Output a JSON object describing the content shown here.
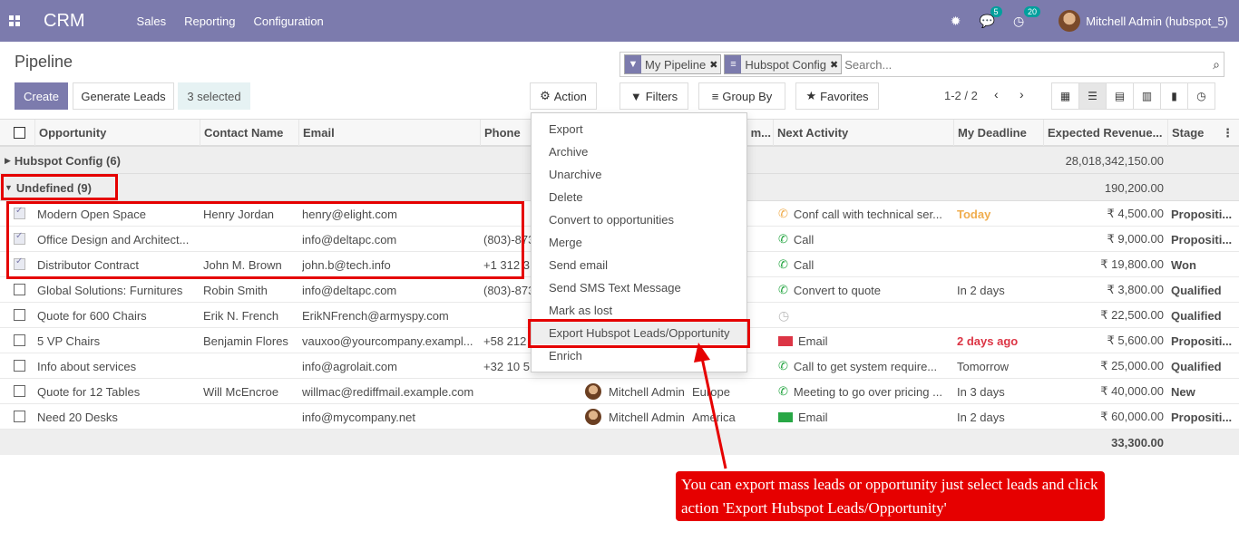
{
  "navbar": {
    "brand": "CRM",
    "menus": [
      "Sales",
      "Reporting",
      "Configuration"
    ],
    "messages_count": "5",
    "activities_count": "20",
    "user": "Mitchell Admin (hubspot_5)"
  },
  "control": {
    "breadcrumb": "Pipeline",
    "create": "Create",
    "generate_leads": "Generate Leads",
    "selected": "3 selected",
    "action": "Action",
    "filters": "Filters",
    "group_by": "Group By",
    "favorites": "Favorites",
    "pager": "1-2 / 2",
    "search_placeholder": "Search...",
    "facets": [
      "My Pipeline",
      "Hubspot Config"
    ]
  },
  "table": {
    "headers": [
      "Opportunity",
      "Contact Name",
      "Email",
      "Phone",
      "m...",
      "Next Activity",
      "My Deadline",
      "Expected Revenue...",
      "Stage"
    ],
    "groups": [
      {
        "label": "Hubspot Config (6)",
        "total": "28,018,342,150.00"
      },
      {
        "label": "Undefined (9)",
        "total": "190,200.00"
      }
    ],
    "rows": [
      {
        "opp": "Modern Open Space",
        "contact": "Henry Jordan",
        "email": "henry@elight.com",
        "phone": "",
        "salesperson": "",
        "team": "",
        "activity": "Conf call with technical ser...",
        "deadline": "Today",
        "revenue": "₹ 4,500.00",
        "stage": "Propositi..."
      },
      {
        "opp": "Office Design and Architect...",
        "contact": "",
        "email": "info@deltapc.com",
        "phone": "(803)-873",
        "salesperson": "",
        "team": "",
        "activity": "Call",
        "deadline": "",
        "revenue": "₹ 9,000.00",
        "stage": "Propositi..."
      },
      {
        "opp": "Distributor Contract",
        "contact": "John M. Brown",
        "email": "john.b@tech.info",
        "phone": "+1 312 3",
        "salesperson": "",
        "team": "",
        "activity": "Call",
        "deadline": "",
        "revenue": "₹ 19,800.00",
        "stage": "Won"
      },
      {
        "opp": "Global Solutions: Furnitures",
        "contact": "Robin Smith",
        "email": "info@deltapc.com",
        "phone": "(803)-873",
        "salesperson": "",
        "team": "",
        "activity": "Convert to quote",
        "deadline": "In 2 days",
        "revenue": "₹ 3,800.00",
        "stage": "Qualified"
      },
      {
        "opp": "Quote for 600 Chairs",
        "contact": "Erik N. French",
        "email": "ErikNFrench@armyspy.com",
        "phone": "",
        "salesperson": "",
        "team": "",
        "activity": "",
        "deadline": "",
        "revenue": "₹ 22,500.00",
        "stage": "Qualified"
      },
      {
        "opp": "5 VP Chairs",
        "contact": "Benjamin Flores",
        "email": "vauxoo@yourcompany.exampl...",
        "phone": "+58 212",
        "salesperson": "",
        "team": "",
        "activity": "Email",
        "deadline": "2 days ago",
        "revenue": "₹ 5,600.00",
        "stage": "Propositi..."
      },
      {
        "opp": "Info about services",
        "contact": "",
        "email": "info@agrolait.com",
        "phone": "+32 10 5",
        "salesperson": "",
        "team": "",
        "activity": "Call to get system require...",
        "deadline": "Tomorrow",
        "revenue": "₹ 25,000.00",
        "stage": "Qualified"
      },
      {
        "opp": "Quote for 12 Tables",
        "contact": "Will McEncroe",
        "email": "willmac@rediffmail.example.com",
        "phone": "",
        "salesperson": "Mitchell Admin",
        "team": "Europe",
        "activity": "Meeting to go over pricing ...",
        "deadline": "In 3 days",
        "revenue": "₹ 40,000.00",
        "stage": "New"
      },
      {
        "opp": "Need 20 Desks",
        "contact": "",
        "email": "info@mycompany.net",
        "phone": "",
        "salesperson": "Mitchell Admin",
        "team": "America",
        "activity": "Email",
        "deadline": "In 2 days",
        "revenue": "₹ 60,000.00",
        "stage": "Propositi..."
      }
    ],
    "footer_total": "33,300.00"
  },
  "dropdown": {
    "items": [
      "Export",
      "Archive",
      "Unarchive",
      "Delete",
      "Convert to opportunities",
      "Merge",
      "Send email",
      "Send SMS Text Message",
      "Mark as lost",
      "Export Hubspot Leads/Opportunity",
      "Enrich"
    ]
  },
  "callout": {
    "text": "You can export mass leads or opportunity just select leads and click action 'Export Hubspot Leads/Opportunity'"
  },
  "colors": {
    "navbar": "#7c7bad",
    "annotation_red": "#e60000"
  }
}
